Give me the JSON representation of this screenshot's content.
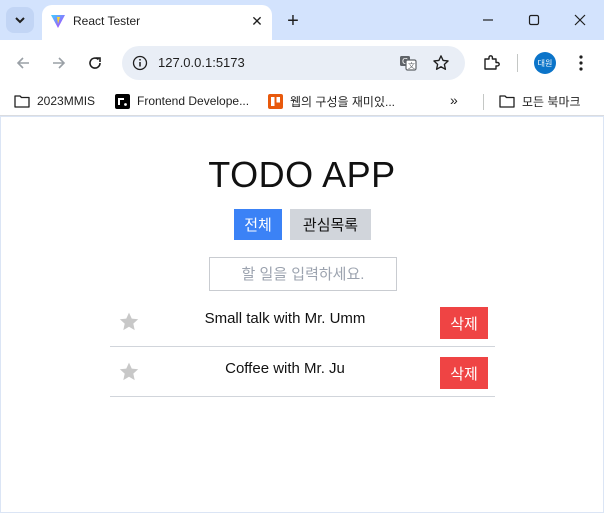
{
  "browser": {
    "tab": {
      "title": "React Tester",
      "close_glyph": "✕",
      "favicon": "vite-logo-icon"
    },
    "new_tab_glyph": "+",
    "window_controls": {
      "minimize": "—",
      "maximize": "☐",
      "close": "✕"
    },
    "url": "127.0.0.1:5173",
    "profile_initials": "대원",
    "profile_color": "#0b74c9",
    "bookmarks": [
      {
        "label": "2023MMIS",
        "icon": "folder-icon"
      },
      {
        "label": "Frontend Develope...",
        "icon": "roadmap-favicon-icon"
      },
      {
        "label": "웹의 구성을 재미있...",
        "icon": "orange-favicon-icon"
      }
    ],
    "bookmarks_overflow": "»",
    "all_bookmarks": "모든 북마크"
  },
  "app": {
    "title": "TODO APP",
    "filters": {
      "all": "전체",
      "favorites": "관심목록"
    },
    "filter_colors": {
      "active": "#3b82f6",
      "inactive": "#d1d5db"
    },
    "input_placeholder": "할 일을 입력하세요.",
    "todos": [
      {
        "text": "Small talk with Mr. Umm",
        "favorite": false
      },
      {
        "text": "Coffee with Mr. Ju",
        "favorite": false
      }
    ],
    "delete_label": "삭제",
    "delete_color": "#ef4444",
    "star_color": "#c8c8c8"
  }
}
